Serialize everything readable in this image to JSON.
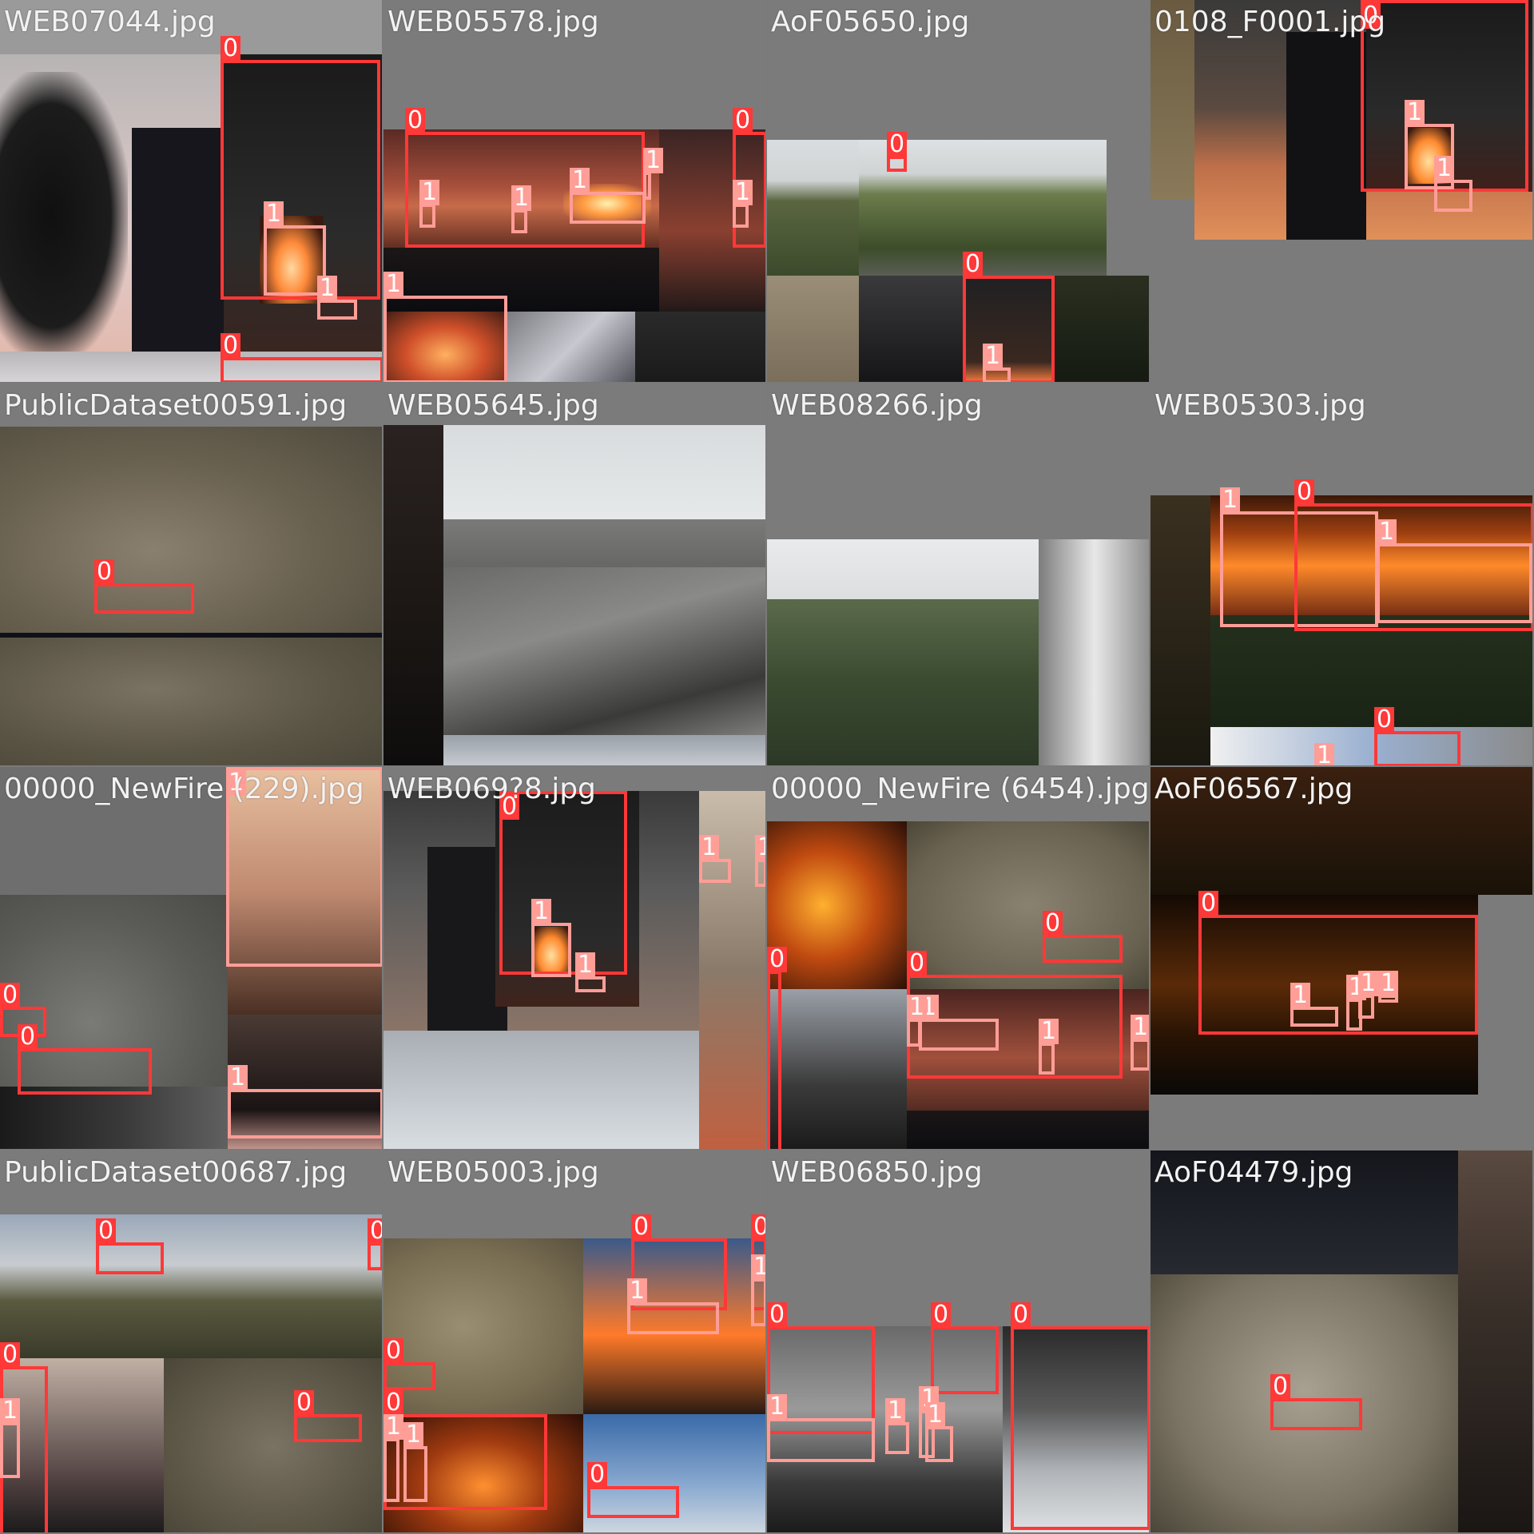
{
  "colors": {
    "class_0": "#ff3838",
    "class_1": "#ff9d97",
    "tile_background": "#7b7b7b"
  },
  "tiles": [
    {
      "filename": "WEB07044.jpg",
      "labels": [
        "0",
        "1",
        "1",
        "0"
      ]
    },
    {
      "filename": "WEB05578.jpg",
      "labels": [
        "0",
        "0",
        "1",
        "1",
        "1",
        "1",
        "1",
        "1"
      ]
    },
    {
      "filename": "AoF05650.jpg",
      "labels": [
        "0",
        "0",
        "1"
      ]
    },
    {
      "filename": "0108_F0001.jpg",
      "labels": [
        "0",
        "1",
        "1"
      ]
    },
    {
      "filename": "PublicDataset00591.jpg",
      "labels": [
        "0"
      ]
    },
    {
      "filename": "WEB05645.jpg",
      "labels": []
    },
    {
      "filename": "WEB08266.jpg",
      "labels": []
    },
    {
      "filename": "WEB05303.jpg",
      "labels": [
        "1",
        "0",
        "1",
        "0",
        "1"
      ]
    },
    {
      "filename": "00000_NewFire (229).jpg",
      "labels": [
        "1",
        "0",
        "0",
        "1"
      ]
    },
    {
      "filename": "WEB069?8.jpg",
      "labels": [
        "0",
        "1",
        "1",
        "1",
        "1"
      ]
    },
    {
      "filename": "00000_NewFire (6454).jpg",
      "labels": [
        "0",
        "0",
        "0",
        "1",
        "1",
        "1",
        "1"
      ]
    },
    {
      "filename": "AoF06567.jpg",
      "labels": [
        "0",
        "1",
        "1",
        "1",
        "1"
      ]
    },
    {
      "filename": "PublicDataset00687.jpg",
      "labels": [
        "0",
        "0",
        "0",
        "1",
        "0"
      ]
    },
    {
      "filename": "WEB05003.jpg",
      "labels": [
        "0",
        "0",
        "0",
        "1",
        "1",
        "0",
        "1",
        "1",
        "0"
      ]
    },
    {
      "filename": "WEB06850.jpg",
      "labels": [
        "0",
        "0",
        "0",
        "1",
        "1",
        "1",
        "1"
      ]
    },
    {
      "filename": "AoF04479.jpg",
      "labels": [
        "0"
      ]
    }
  ]
}
